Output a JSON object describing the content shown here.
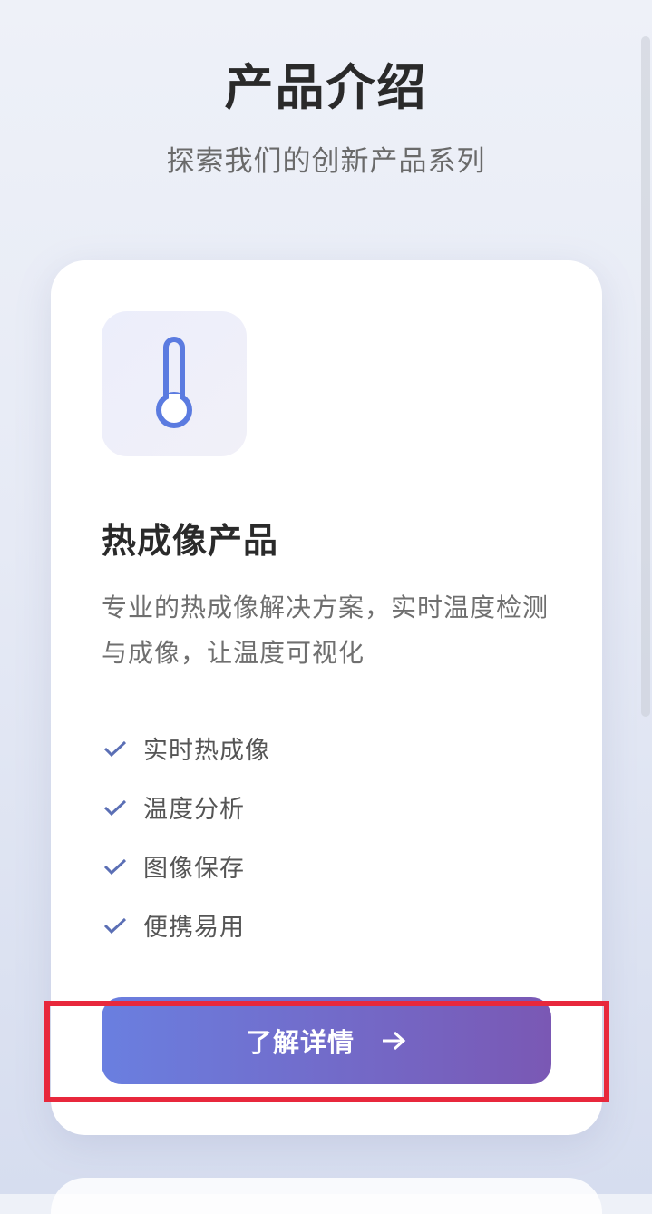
{
  "header": {
    "title": "产品介绍",
    "subtitle": "探索我们的创新产品系列"
  },
  "product_card": {
    "icon": "thermometer-icon",
    "title": "热成像产品",
    "description": "专业的热成像解决方案，实时温度检测与成像，让温度可视化",
    "features": [
      {
        "label": "实时热成像",
        "icon": "check-icon"
      },
      {
        "label": "温度分析",
        "icon": "check-icon"
      },
      {
        "label": "图像保存",
        "icon": "check-icon"
      },
      {
        "label": "便携易用",
        "icon": "check-icon"
      }
    ],
    "button": {
      "label": "了解详情",
      "icon": "arrow-right-icon"
    }
  },
  "colors": {
    "accent": "#6a7fe0",
    "accent_end": "#7a58b4",
    "icon_blue": "#5b7be0",
    "highlight": "#e8283c"
  }
}
